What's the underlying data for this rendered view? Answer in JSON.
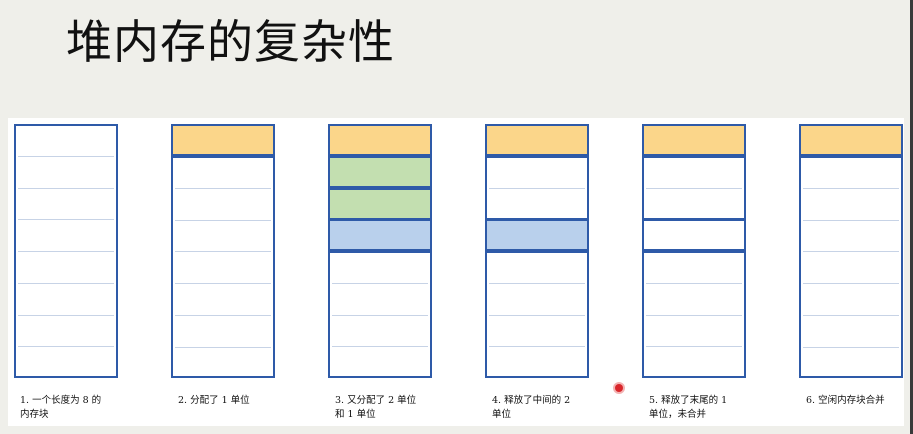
{
  "title": "堆内存的复杂性",
  "colors": {
    "border": "#2e5aa8",
    "yellow": "#fbd68a",
    "green": "#c3dfb0",
    "blue": "#b9d0ec",
    "white": "#ffffff",
    "slot_line": "#c7d3e6"
  },
  "memory_size": 8,
  "columns": [
    {
      "caption": "1. 一个长度为 8 的\n内存块",
      "blocks": [
        {
          "start": 0,
          "size": 8,
          "fill": "white"
        }
      ]
    },
    {
      "caption": "2. 分配了 1 单位",
      "blocks": [
        {
          "start": 0,
          "size": 1,
          "fill": "yellow"
        },
        {
          "start": 1,
          "size": 7,
          "fill": "white"
        }
      ]
    },
    {
      "caption": "3. 又分配了 2 单位\n和 1 单位",
      "blocks": [
        {
          "start": 0,
          "size": 1,
          "fill": "yellow"
        },
        {
          "start": 1,
          "size": 1,
          "fill": "green"
        },
        {
          "start": 2,
          "size": 1,
          "fill": "green"
        },
        {
          "start": 3,
          "size": 1,
          "fill": "blue"
        },
        {
          "start": 4,
          "size": 4,
          "fill": "white"
        }
      ]
    },
    {
      "caption": "4. 释放了中间的 2\n单位",
      "blocks": [
        {
          "start": 0,
          "size": 1,
          "fill": "yellow"
        },
        {
          "start": 1,
          "size": 2,
          "fill": "white"
        },
        {
          "start": 3,
          "size": 1,
          "fill": "blue"
        },
        {
          "start": 4,
          "size": 4,
          "fill": "white"
        }
      ]
    },
    {
      "caption": "5. 释放了末尾的 1\n单位，未合并",
      "blocks": [
        {
          "start": 0,
          "size": 1,
          "fill": "yellow"
        },
        {
          "start": 1,
          "size": 2,
          "fill": "white"
        },
        {
          "start": 3,
          "size": 1,
          "fill": "white"
        },
        {
          "start": 4,
          "size": 4,
          "fill": "white"
        }
      ]
    },
    {
      "caption": "6. 空闲内存块合并",
      "blocks": [
        {
          "start": 0,
          "size": 1,
          "fill": "yellow"
        },
        {
          "start": 1,
          "size": 7,
          "fill": "white"
        }
      ]
    }
  ]
}
